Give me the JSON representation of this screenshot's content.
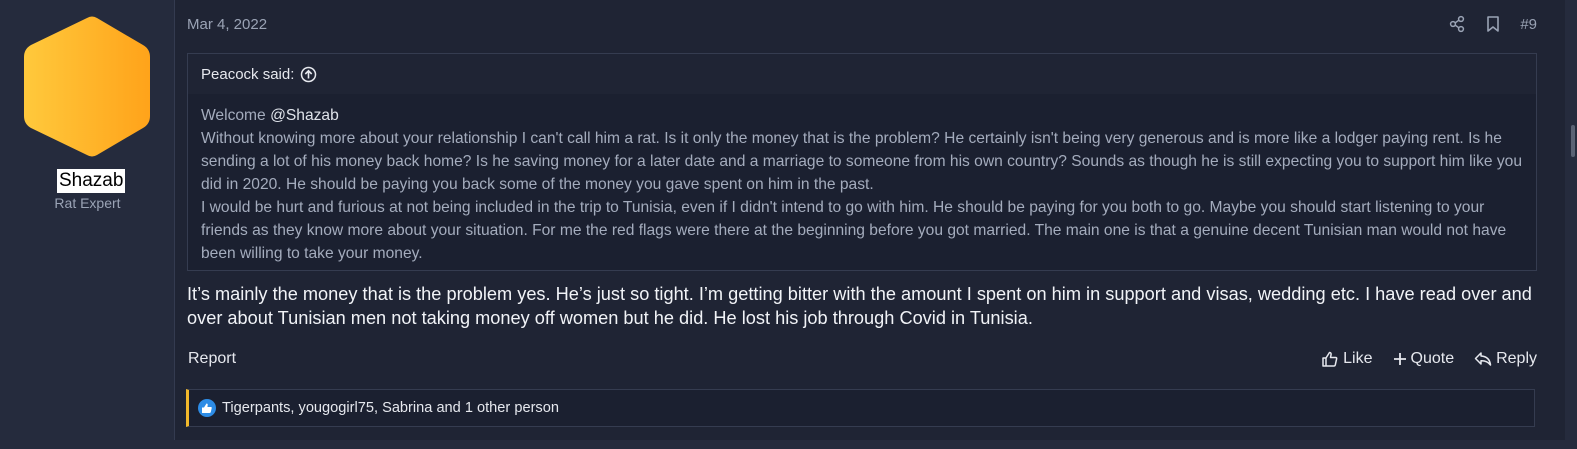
{
  "author": {
    "username": "Shazab",
    "title": "Rat Expert",
    "avatar_colors": [
      "#ffc93c",
      "#ffa31a"
    ]
  },
  "post": {
    "date": "Mar 4, 2022",
    "number": "#9",
    "header_icons": [
      "share-icon",
      "bookmark-icon"
    ]
  },
  "quote": {
    "author_line": "Peacock said:",
    "greeting": "Welcome",
    "mention": "@Shazab",
    "paragraph1": "Without knowing more about your relationship I can't call him a rat. Is it only the money that is the problem? He certainly isn't being very generous and is more like a lodger paying rent. Is he sending a lot of his money back home? Is he saving money for a later date and a marriage to someone from his own country? Sounds as though he is still expecting you to support him like you did in 2020. He should be paying you back some of the money you gave spent on him in the past.",
    "paragraph2": "I would be hurt and furious at not being included in the trip to Tunisia, even if I didn't intend to go with him. He should be paying for you both to go. Maybe you should start listening to your friends as they know more about your situation. For me the red flags were there at the beginning before you got married. The main one is that a genuine decent Tunisian man would not have been willing to take your money."
  },
  "message": {
    "text": "It’s mainly the money that is the problem yes. He’s just so tight. I’m getting bitter with the amount I spent on him in support and visas, wedding etc. I have read over and over about Tunisian men not taking money off women but he did. He lost his job through Covid in Tunisia."
  },
  "footer": {
    "report": "Report",
    "like": "Like",
    "quote": "Quote",
    "reply": "Reply"
  },
  "reactions": {
    "text": "Tigerpants, yougogirl75, Sabrina and 1 other person"
  },
  "colors": {
    "background": "#252b3d",
    "message_bg": "#1f2434",
    "reaction_accent": "#f1b82b",
    "like_badge": "#2d8ce6"
  }
}
